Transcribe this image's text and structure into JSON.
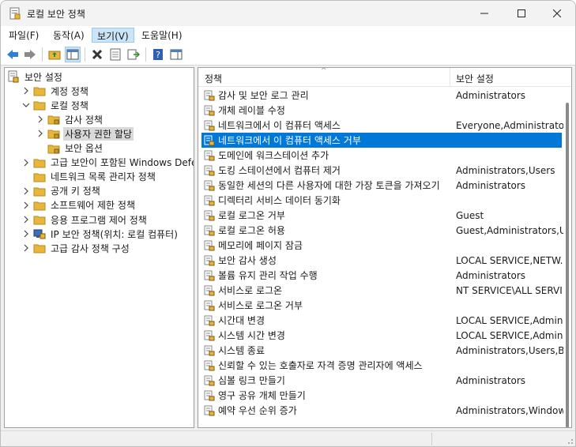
{
  "window": {
    "title": "로컬 보안 정책"
  },
  "menu": [
    {
      "label": "파일(F)",
      "active": false
    },
    {
      "label": "동작(A)",
      "active": false
    },
    {
      "label": "보기(V)",
      "active": true
    },
    {
      "label": "도움말(H)",
      "active": false
    }
  ],
  "icons": {
    "app": "security-policy-icon",
    "back": "arrow-left-icon",
    "forward": "arrow-right-icon",
    "up": "folder-up-icon",
    "show_tree": "show-hide-tree-icon",
    "delete": "delete-x-icon",
    "properties": "properties-icon",
    "export": "export-list-icon",
    "help": "help-icon",
    "show_hide": "show-hide-action-pane-icon"
  },
  "colors": {
    "selection": "#0078d7",
    "tree_selection": "#d9d9d9",
    "folder": "#e8b73a"
  },
  "tree": [
    {
      "label": "보안 설정",
      "level": 0,
      "twisty": "none",
      "icon": "security-settings-icon",
      "selected": false
    },
    {
      "label": "계정 정책",
      "level": 1,
      "twisty": "collapsed",
      "icon": "folder-icon",
      "selected": false
    },
    {
      "label": "로컬 정책",
      "level": 1,
      "twisty": "expanded",
      "icon": "folder-icon",
      "selected": false
    },
    {
      "label": "감사 정책",
      "level": 2,
      "twisty": "collapsed",
      "icon": "folder-lock-icon",
      "selected": false
    },
    {
      "label": "사용자 권한 할당",
      "level": 2,
      "twisty": "collapsed",
      "icon": "folder-lock-icon",
      "selected": true
    },
    {
      "label": "보안 옵션",
      "level": 2,
      "twisty": "none",
      "icon": "folder-lock-icon",
      "selected": false
    },
    {
      "label": "고급 보안이 포함된 Windows Defender 방화벽",
      "level": 1,
      "twisty": "collapsed",
      "icon": "folder-icon",
      "selected": false
    },
    {
      "label": "네트워크 목록 관리자 정책",
      "level": 1,
      "twisty": "none",
      "icon": "folder-icon",
      "selected": false
    },
    {
      "label": "공개 키 정책",
      "level": 1,
      "twisty": "collapsed",
      "icon": "folder-icon",
      "selected": false
    },
    {
      "label": "소프트웨어 제한 정책",
      "level": 1,
      "twisty": "collapsed",
      "icon": "folder-icon",
      "selected": false
    },
    {
      "label": "응용 프로그램 제어 정책",
      "level": 1,
      "twisty": "collapsed",
      "icon": "folder-icon",
      "selected": false
    },
    {
      "label": "IP 보안 정책(위치: 로컬 컴퓨터)",
      "level": 1,
      "twisty": "collapsed",
      "icon": "ip-security-icon",
      "selected": false
    },
    {
      "label": "고급 감사 정책 구성",
      "level": 1,
      "twisty": "collapsed",
      "icon": "folder-icon",
      "selected": false
    }
  ],
  "list": {
    "headers": {
      "policy": "정책",
      "setting": "보안 설정"
    },
    "rows": [
      {
        "policy": "감사 및 보안 로그 관리",
        "setting": "Administrators",
        "selected": false
      },
      {
        "policy": "개체 레이블 수정",
        "setting": "",
        "selected": false
      },
      {
        "policy": "네트워크에서 이 컴퓨터 액세스",
        "setting": "Everyone,Administrators...",
        "selected": false
      },
      {
        "policy": "네트워크에서 이 컴퓨터 액세스 거부",
        "setting": "",
        "selected": true
      },
      {
        "policy": "도메인에 워크스테이션 추가",
        "setting": "",
        "selected": false
      },
      {
        "policy": "도킹 스테이션에서 컴퓨터 제거",
        "setting": "Administrators,Users",
        "selected": false
      },
      {
        "policy": "동일한 세션의 다른 사용자에 대한 가장 토큰을 가져오기",
        "setting": "Administrators",
        "selected": false
      },
      {
        "policy": "디렉터리 서비스 데이터 동기화",
        "setting": "",
        "selected": false
      },
      {
        "policy": "로컬 로그온 거부",
        "setting": "Guest",
        "selected": false
      },
      {
        "policy": "로컬 로그온 허용",
        "setting": "Guest,Administrators,Us...",
        "selected": false
      },
      {
        "policy": "메모리에 페이지 잠금",
        "setting": "",
        "selected": false
      },
      {
        "policy": "보안 감사 생성",
        "setting": "LOCAL SERVICE,NETW...",
        "selected": false
      },
      {
        "policy": "볼륨 유지 관리 작업 수행",
        "setting": "Administrators",
        "selected": false
      },
      {
        "policy": "서비스로 로그온",
        "setting": "NT SERVICE\\ALL SERVI...",
        "selected": false
      },
      {
        "policy": "서비스로 로그온 거부",
        "setting": "",
        "selected": false
      },
      {
        "policy": "시간대 변경",
        "setting": "LOCAL SERVICE,Admini...",
        "selected": false
      },
      {
        "policy": "시스템 시간 변경",
        "setting": "LOCAL SERVICE,Admini...",
        "selected": false
      },
      {
        "policy": "시스템 종료",
        "setting": "Administrators,Users,Ba...",
        "selected": false
      },
      {
        "policy": "신뢰할 수 있는 호출자로 자격 증명 관리자에 액세스",
        "setting": "",
        "selected": false
      },
      {
        "policy": "심볼 링크 만들기",
        "setting": "Administrators",
        "selected": false
      },
      {
        "policy": "영구 공유 개체 만들기",
        "setting": "",
        "selected": false
      },
      {
        "policy": "예약 우선 순위 증가",
        "setting": "Administrators,Window ...",
        "selected": false
      }
    ]
  }
}
